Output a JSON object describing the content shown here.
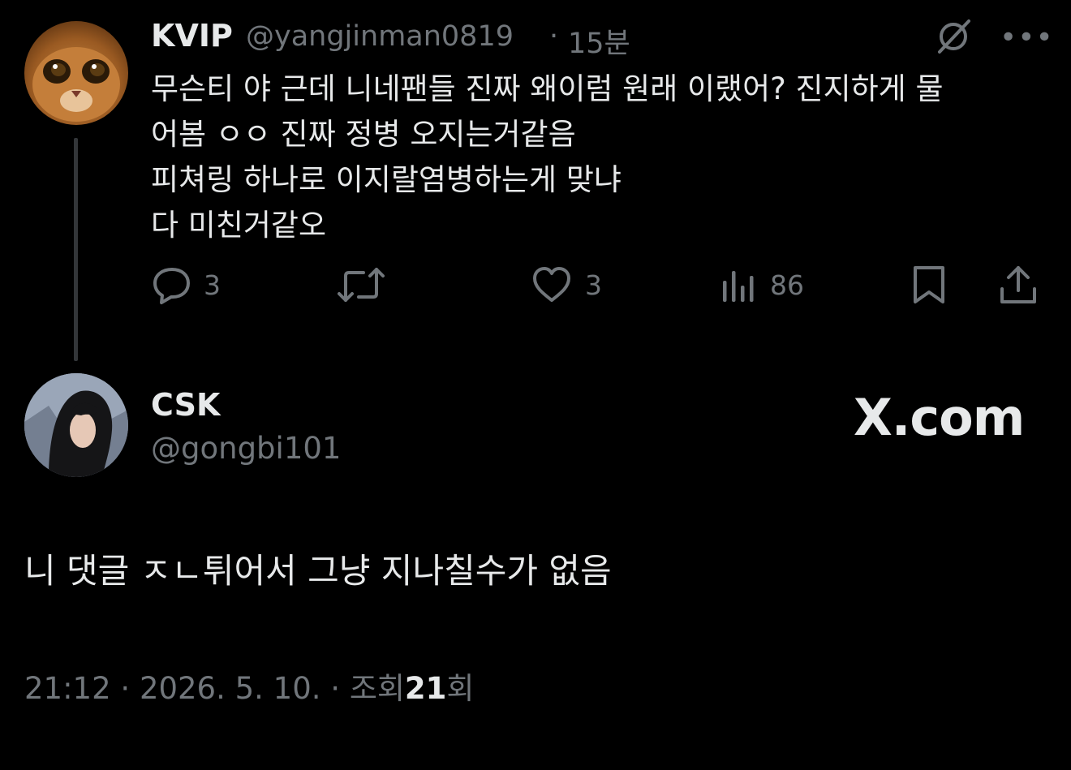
{
  "parent_tweet": {
    "display_name": "KVIP",
    "handle": "@yangjinman0819",
    "separator": "·",
    "time": "15분",
    "lines": [
      "무슨티 야 근데 니네팬들 진짜 왜이럼 원래 이랬어? 진지하게 물",
      "어봄 ㅇㅇ 진짜 정병 오지는거같음",
      "피쳐링 하나로 이지랄염병하는게 맞냐",
      "다 미친거같오"
    ],
    "actions": {
      "replies": "3",
      "likes": "3",
      "views": "86"
    },
    "icons": {
      "grok": "grok-icon",
      "more": "more-icon",
      "reply": "reply-icon",
      "retweet": "retweet-icon",
      "like": "heart-icon",
      "views": "views-icon",
      "bookmark": "bookmark-icon",
      "share": "share-icon"
    }
  },
  "main_tweet": {
    "display_name": "CSK",
    "handle": "@gongbi101",
    "text": "니 댓글 ㅈㄴ튀어서 그냥 지나칠수가 없음",
    "meta": {
      "time": "21:12",
      "sep1": "·",
      "date": "2026. 5. 10.",
      "sep2": "·",
      "views_prefix": "조회",
      "views_count": "21",
      "views_suffix": "회"
    }
  },
  "watermark": "X.com",
  "colors": {
    "background": "#000000",
    "text": "#e7e9ea",
    "muted": "#71767b",
    "thread_line": "#333639"
  }
}
